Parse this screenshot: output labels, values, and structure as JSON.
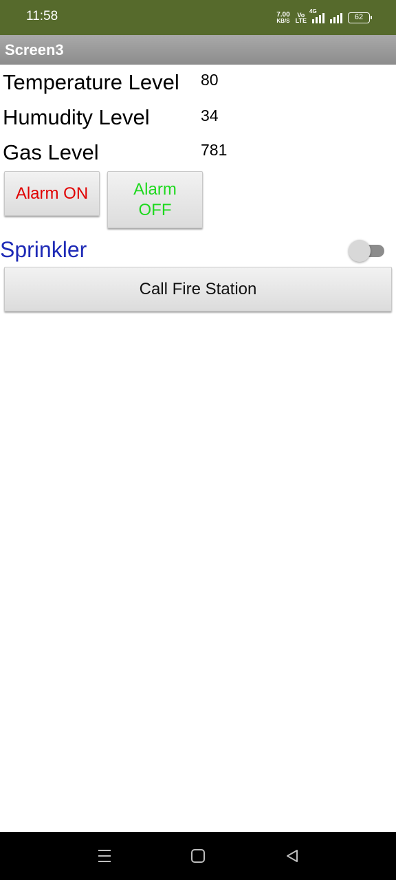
{
  "status_bar": {
    "time": "11:58",
    "net_speed_value": "7.00",
    "net_speed_unit": "KB/S",
    "volte_top": "Vo",
    "volte_bottom": "LTE",
    "network_type": "4G",
    "battery": "62",
    "background_color": "#566a2c"
  },
  "app": {
    "title": "Screen3"
  },
  "readings": [
    {
      "label": "Temperature Level",
      "value": "80"
    },
    {
      "label": "Humudity Level",
      "value": "34"
    },
    {
      "label": "Gas Level",
      "value": "781"
    }
  ],
  "alarm": {
    "on_label": "Alarm ON",
    "off_label_line1": "Alarm",
    "off_label_line2": "OFF",
    "on_color": "#e00000",
    "off_color": "#1ed91e"
  },
  "sprinkler": {
    "label": "Sprinkler",
    "enabled": false,
    "label_color": "#1e2ab6"
  },
  "call_button": {
    "label": "Call Fire Station"
  },
  "nav_bar": {
    "icons": [
      "menu-icon",
      "home-icon",
      "back-icon"
    ]
  }
}
